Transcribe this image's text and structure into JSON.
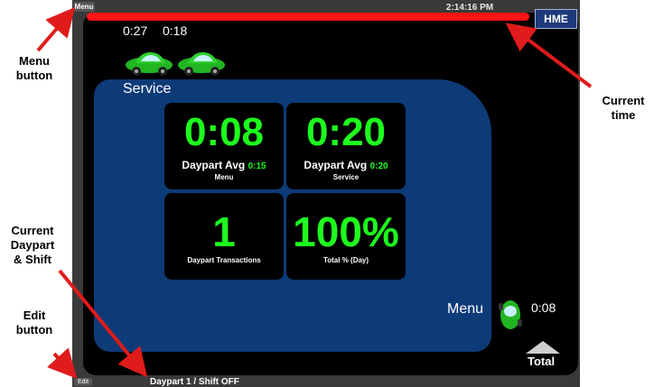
{
  "device": {
    "menu_button_label": "Menu",
    "clock": "2:14:16 PM",
    "brand": "HME",
    "top_timers": [
      "0:27",
      "0:18"
    ],
    "service": {
      "title": "Service",
      "tiles": [
        {
          "value": "0:08",
          "avg_label": "Daypart Avg",
          "avg_value": "0:15",
          "caption": "Menu"
        },
        {
          "value": "0:20",
          "avg_label": "Daypart Avg",
          "avg_value": "0:20",
          "caption": "Service"
        },
        {
          "value": "1",
          "caption": "Daypart Transactions"
        },
        {
          "value": "100%",
          "caption": "Total % (Day)"
        }
      ]
    },
    "menu_lane": {
      "label": "Menu",
      "time": "0:08"
    },
    "total_label": "Total",
    "edit_button_label": "Edit",
    "daypart_shift": "Daypart 1 / Shift OFF"
  },
  "annotations": {
    "menu_button": [
      "Menu",
      "button"
    ],
    "current_time": [
      "Current",
      "time"
    ],
    "current_daypart": [
      "Current",
      "Daypart",
      "& Shift"
    ],
    "edit_button": [
      "Edit",
      "button"
    ]
  },
  "colors": {
    "accent_green": "#1dff1d",
    "panel_blue": "#0d3b78",
    "alert_red": "#ff1414",
    "arrow_red": "#e01b1b"
  }
}
